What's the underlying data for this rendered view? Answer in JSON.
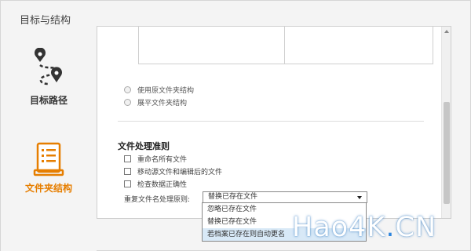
{
  "window": {
    "title": "目标与结构"
  },
  "nav": {
    "items": [
      {
        "label": "目标路径",
        "icon": "route-map-pin-icon"
      },
      {
        "label": "文件夹结构",
        "icon": "folder-structure-document-icon",
        "active_color": "#e67e00"
      }
    ]
  },
  "structure": {
    "options": [
      {
        "label": "使用原文件夹结构"
      },
      {
        "label": "展平文件夹结构"
      }
    ]
  },
  "rules": {
    "title": "文件处理准则",
    "checkboxes": [
      {
        "label": "重命名所有文件",
        "checked": false
      },
      {
        "label": "移动源文件和编辑后的文件",
        "checked": false
      },
      {
        "label": "检查数据正确性",
        "checked": false
      }
    ],
    "duplicate_label": "重复文件名处理原则:",
    "duplicate_selected": "替换已存在文件",
    "duplicate_options": [
      {
        "label": "忽略已存在文件"
      },
      {
        "label": "替换已存在文件"
      },
      {
        "label": "若档案已存在则自动更名"
      }
    ]
  },
  "watermark": {
    "prefix": "Hao4K",
    "dot": ".",
    "suffix": "CN"
  }
}
